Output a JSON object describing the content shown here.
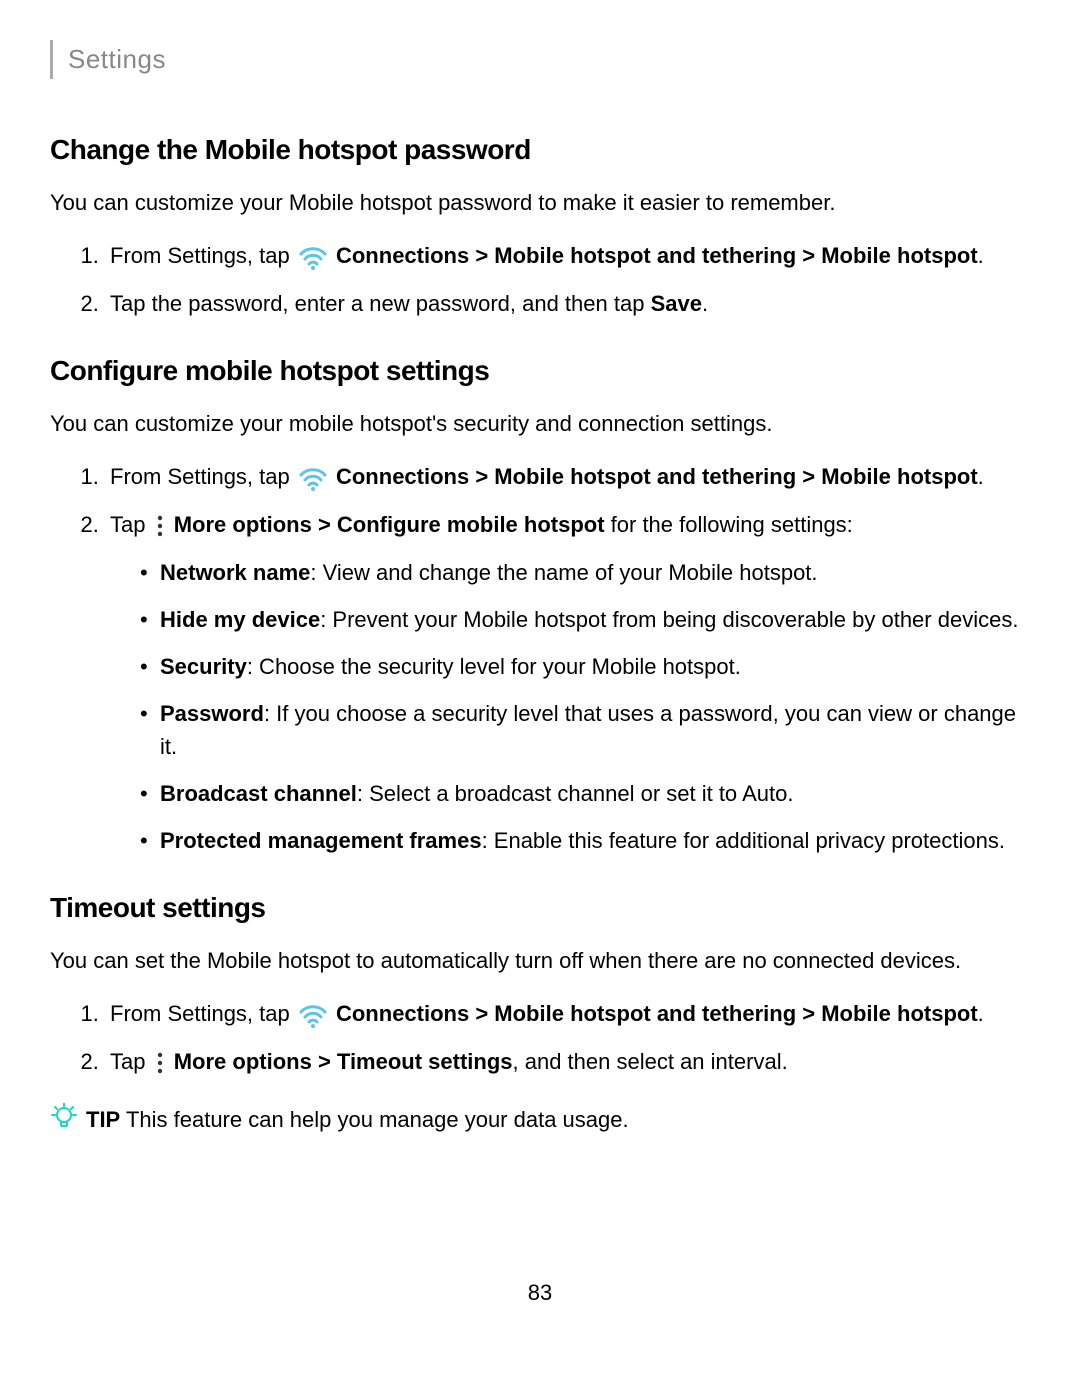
{
  "breadcrumb": "Settings",
  "pageNumber": "83",
  "labels": {
    "connections": "Connections",
    "path1": " > Mobile hotspot and tethering > Mobile hotspot",
    "moreOptions": "More options",
    "save": "Save",
    "tip": "TIP"
  },
  "section1": {
    "heading": "Change the Mobile hotspot password",
    "intro": "You can customize your Mobile hotspot password to make it easier to remember.",
    "step1_prefix": "From Settings, tap ",
    "step1_suffix": ".",
    "step2_a": "Tap the password, enter a new password, and then tap ",
    "step2_b": "."
  },
  "section2": {
    "heading": "Configure mobile hotspot settings",
    "intro": "You can customize your mobile hotspot's security and connection settings.",
    "step1_prefix": "From Settings, tap ",
    "step1_suffix": ".",
    "step2_a": "Tap ",
    "step2_b": " > Configure mobile hotspot",
    "step2_c": " for the following settings:",
    "bullets": [
      {
        "label": "Network name",
        "text": ": View and change the name of your Mobile hotspot."
      },
      {
        "label": "Hide my device",
        "text": ": Prevent your Mobile hotspot from being discoverable by other devices."
      },
      {
        "label": "Security",
        "text": ": Choose the security level for your Mobile hotspot."
      },
      {
        "label": "Password",
        "text": ": If you choose a security level that uses a password, you can view or change it."
      },
      {
        "label": "Broadcast channel",
        "text": ": Select a broadcast channel or set it to Auto."
      },
      {
        "label": "Protected management frames",
        "text": ": Enable this feature for additional privacy protections."
      }
    ]
  },
  "section3": {
    "heading": "Timeout settings",
    "intro": "You can set the Mobile hotspot to automatically turn off when there are no connected devices.",
    "step1_prefix": "From Settings, tap ",
    "step1_suffix": ".",
    "step2_a": "Tap ",
    "step2_b": " > Timeout settings",
    "step2_c": ", and then select an interval.",
    "tipText": " This feature can help you manage your data usage."
  }
}
